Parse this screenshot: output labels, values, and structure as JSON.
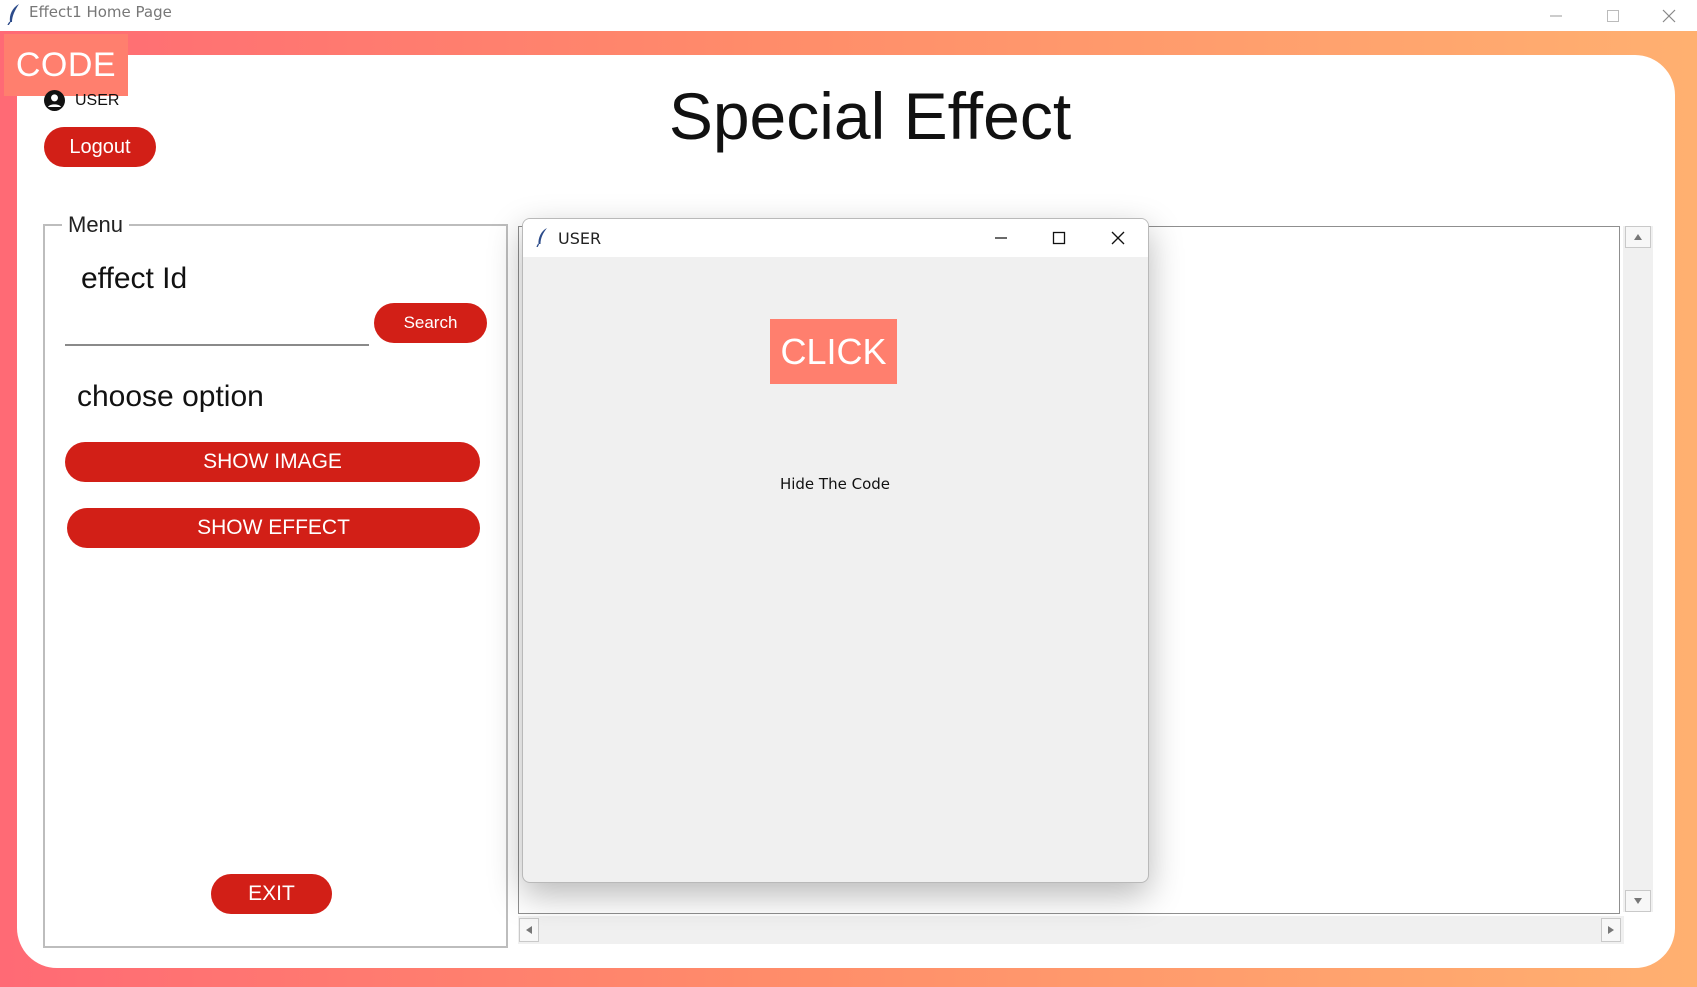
{
  "window": {
    "title": "Effect1 Home Page",
    "minimize_icon": "minimize-icon",
    "maximize_icon": "maximize-icon",
    "close_icon": "close-icon"
  },
  "badge": {
    "text": "CODE"
  },
  "user": {
    "label": "USER",
    "icon": "user-icon"
  },
  "logout_label": "Logout",
  "heading": "Special Effect",
  "menu": {
    "legend": "Menu",
    "effect_id_label": "effect Id",
    "effect_id_value": "",
    "search_label": "Search",
    "choose_label": "choose option",
    "show_image_label": "SHOW IMAGE",
    "show_effect_label": "SHOW EFFECT",
    "exit_label": "EXIT"
  },
  "dialog": {
    "title": "USER",
    "click_label": "CLICK",
    "hide_text": "Hide The Code"
  },
  "colors": {
    "accent_red": "#d21f17",
    "badge_salmon": "#ff7f6e",
    "gradient_start": "#ff6a75",
    "gradient_end": "#ffb070"
  }
}
